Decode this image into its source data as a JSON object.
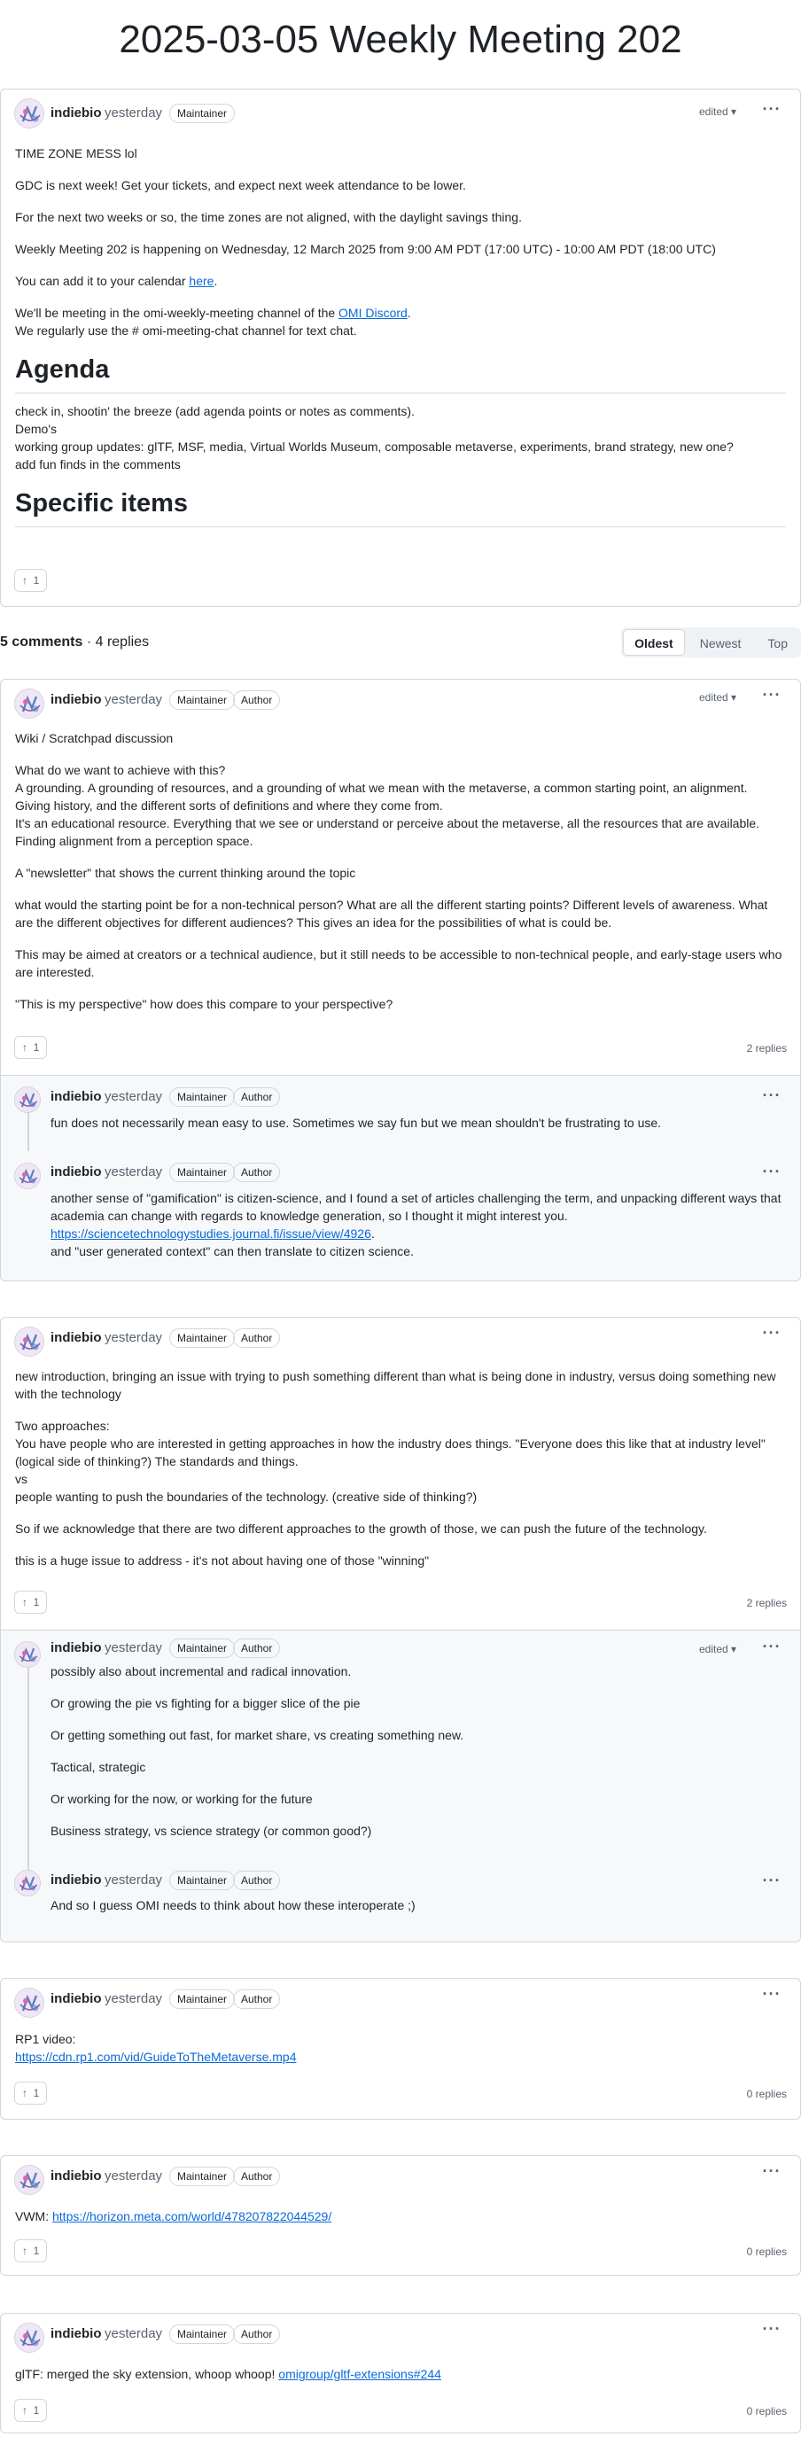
{
  "page": {
    "title": "2025-03-05 Weekly Meeting 202"
  },
  "common": {
    "author": "indiebio",
    "time": "yesterday",
    "maintainer": "Maintainer",
    "author_badge": "Author",
    "edited": "edited",
    "kebab": "···"
  },
  "post": {
    "p1": "TIME ZONE MESS lol",
    "p2": "GDC is next week! Get your tickets, and expect next week attendance to be lower.",
    "p3": "For the next two weeks or so, the time zones are not aligned, with the daylight savings thing.",
    "p4": "Weekly Meeting 202 is happening on Wednesday, 12 March 2025 from 9:00 AM PDT (17:00 UTC) - 10:00 AM PDT (18:00 UTC)",
    "p5_pre": "You can add it to your calendar ",
    "p5_link": "here",
    "p5_post": ".",
    "p6_pre": "We'll be meeting in the omi-weekly-meeting channel of the ",
    "p6_link": "OMI Discord",
    "p6_post": ".",
    "p6b": "We regularly use the # omi-meeting-chat channel for text chat.",
    "agenda_heading": "Agenda",
    "agenda": [
      "check in, shootin' the breeze (add agenda points or notes as comments).",
      "Demo's",
      "working group updates: glTF, MSF, media, Virtual Worlds Museum, composable metaverse, experiments, brand strategy, new one?",
      "add fun finds in the comments"
    ],
    "specific_heading": "Specific items",
    "votes": "1"
  },
  "comments_header": {
    "count": "5 comments",
    "sep": " · ",
    "replies": "4 replies",
    "sort": [
      "Oldest",
      "Newest",
      "Top"
    ]
  },
  "c1": {
    "p1": "Wiki / Scratchpad discussion",
    "p2": [
      "What do we want to achieve with this?",
      "A grounding. A grounding of resources, and a grounding of what we mean with the metaverse, a common starting point, an alignment.",
      "Giving history, and the different sorts of definitions and where they come from.",
      "It's an educational resource. Everything that we see or understand or perceive about the metaverse, all the resources that are available.",
      "Finding alignment from a perception space."
    ],
    "p3": "A \"newsletter\" that shows the current thinking around the topic",
    "p4": "what would the starting point be for a non-technical person? What are all the different starting points? Different levels of awareness. What are the different objectives for different audiences? This gives an idea for the possibilities of what is could be.",
    "p5": "This may be aimed at creators or a technical audience, but it still needs to be accessible to non-technical people, and early-stage users who are interested.",
    "p6": "\"This is my perspective\" how does this compare to your perspective?",
    "votes": "1",
    "replies": "2 replies",
    "r1": "fun does not necessarily mean easy to use. Sometimes we say fun but we mean shouldn't be frustrating to use.",
    "r2_text": "another sense of \"gamification\" is citizen-science, and I found a set of articles challenging the term, and unpacking different ways that academia can change with regards to knowledge generation, so I thought it might interest you.",
    "r2_link": "https://sciencetechnologystudies.journal.fi/issue/view/4926",
    "r2_link_post": ".",
    "r2_tail": "and \"user generated context\" can then translate to citizen science."
  },
  "c2": {
    "p1": "new introduction, bringing an issue with trying to push something different than what is being done in industry, versus doing something new with the technology",
    "p2": [
      "Two approaches:",
      "You have people who are interested in getting approaches in how the industry does things. \"Everyone does this like that at industry level\" (logical side of thinking?) The standards and things.",
      "vs",
      "people wanting to push the boundaries of the technology. (creative side of thinking?)"
    ],
    "p3": "So if we acknowledge that there are two different approaches to the growth of those, we can push the future of the technology.",
    "p4": "this is a huge issue to address - it's not about having one of those \"winning\"",
    "votes": "1",
    "replies": "2 replies",
    "r1": [
      "possibly also about incremental and radical innovation.",
      "Or growing the pie vs fighting for a bigger slice of the pie",
      "Or getting something out fast, for market share, vs creating something new.",
      "Tactical, strategic",
      "Or working for the now, or working for the future",
      "Business strategy, vs science strategy (or common good?)"
    ],
    "r2": "And so I guess OMI needs to think about how these interoperate ;)"
  },
  "c3": {
    "label": "RP1 video:",
    "link": "https://cdn.rp1.com/vid/GuideToTheMetaverse.mp4",
    "votes": "1",
    "replies": "0 replies"
  },
  "c4": {
    "label": "VWM: ",
    "link": "https://horizon.meta.com/world/478207822044529/",
    "votes": "1",
    "replies": "0 replies"
  },
  "c5": {
    "label": "glTF: merged the sky extension, whoop whoop! ",
    "link": "omigroup/gltf-extensions#244",
    "votes": "1",
    "replies": "0 replies"
  }
}
